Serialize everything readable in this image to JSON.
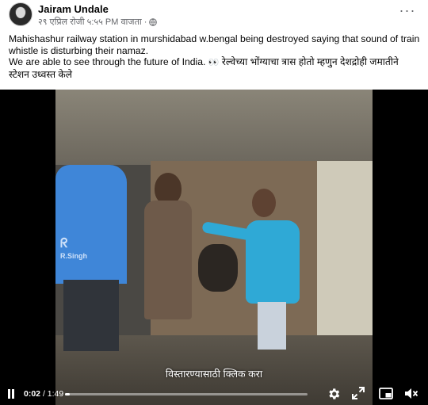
{
  "post": {
    "author": "Jairam Undale",
    "timestamp": "२९ एप्रिल रोजी ५:५५ PM वाजता",
    "separator": "·",
    "privacy_icon": "globe-icon",
    "more_icon": "more-options-icon",
    "more_label": "···",
    "text_lines": [
      "Mahishashur railway station in murshidabad w.bengal being destroyed saying that sound of train whistle is disturbing their namaz.",
      "We are able to see through the future of India. "
    ],
    "emoji": "👀",
    "marathi_text": " रेल्वेच्या भोंग्याचा त्रास होतो म्हणुन देशद्रोही जमातीने स्टेशन उध्वस्त केले"
  },
  "video": {
    "watermark_mark": "ᖇ",
    "watermark": "R.Singh",
    "overlay_label": "विस्तारण्यासाठी क्लिक करा",
    "elapsed": "0:02",
    "duration": "/ 1:49",
    "progress_fraction": 0.018,
    "controls": {
      "play_state_icon": "pause-icon",
      "settings_icon": "gear-icon",
      "expand_icon": "expand-icon",
      "pip_icon": "picture-in-picture-icon",
      "volume_icon": "volume-muted-icon"
    }
  },
  "colors": {
    "author": "#050505",
    "meta": "#65676b",
    "video_bg": "#000000",
    "progress": "#ffffff"
  }
}
